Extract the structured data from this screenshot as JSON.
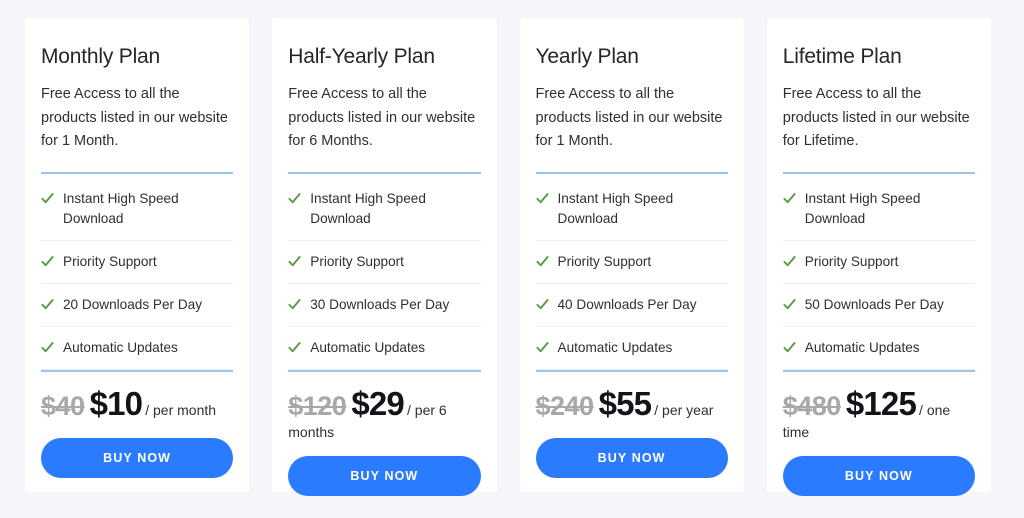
{
  "page": {
    "background_color": "#f4f6fa",
    "accent_color": "#2b7bff",
    "divider_color": "#9dc3e8",
    "check_color": "#5b9a4a"
  },
  "plans": [
    {
      "title": "Monthly Plan",
      "description": "Free Access to all the products listed in our website for 1 Month.",
      "features": [
        "Instant High Speed Download",
        "Priority Support",
        "20 Downloads Per Day",
        "Automatic Updates"
      ],
      "price_old": "$40",
      "price_new": "$10",
      "price_unit": "/ per month",
      "cta_label": "BUY NOW"
    },
    {
      "title": "Half-Yearly Plan",
      "description": "Free Access to all the products listed in our website for 6 Months.",
      "features": [
        "Instant High Speed Download",
        "Priority Support",
        "30 Downloads Per Day",
        "Automatic Updates"
      ],
      "price_old": "$120",
      "price_new": "$29",
      "price_unit": "/ per 6 months",
      "cta_label": "BUY NOW"
    },
    {
      "title": "Yearly Plan",
      "description": "Free Access to all the products listed in our website for 1 Month.",
      "features": [
        "Instant High Speed Download",
        "Priority Support",
        "40 Downloads Per Day",
        "Automatic Updates"
      ],
      "price_old": "$240",
      "price_new": "$55",
      "price_unit": "/ per year",
      "cta_label": "BUY NOW"
    },
    {
      "title": "Lifetime Plan",
      "description": "Free Access to all the products listed in our website for Lifetime.",
      "features": [
        "Instant High Speed Download",
        "Priority Support",
        "50 Downloads Per Day",
        "Automatic Updates"
      ],
      "price_old": "$480",
      "price_new": "$125",
      "price_unit": "/ one time",
      "cta_label": "BUY NOW"
    }
  ],
  "icons": {
    "check": "check-icon"
  }
}
